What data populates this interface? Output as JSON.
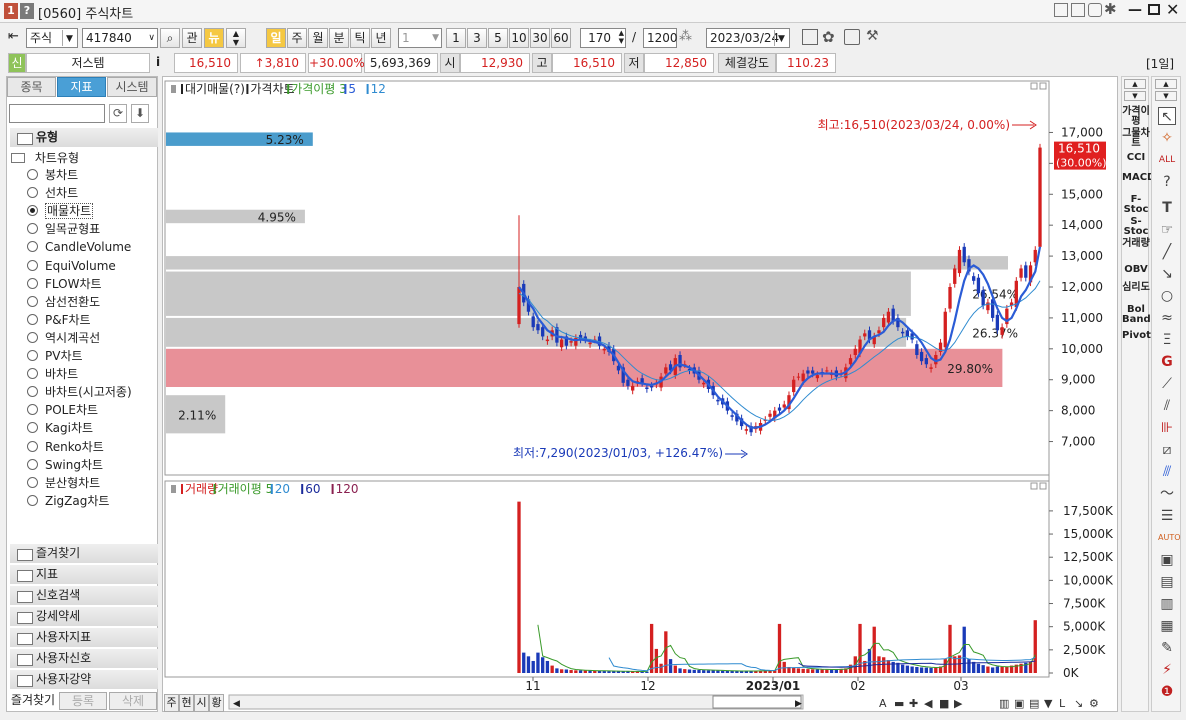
{
  "window": {
    "badge1": "1",
    "badge2": "?",
    "title": "[0560] 주식차트"
  },
  "toolbar": {
    "market": "주식",
    "code": "417840",
    "btn_gwan": "관",
    "btn_news": "뉴",
    "periods": [
      "일",
      "주",
      "월",
      "분",
      "틱",
      "년"
    ],
    "period_selected": "일",
    "interval_value": "1",
    "intervals": [
      "1",
      "3",
      "5",
      "10",
      "30",
      "60"
    ],
    "count": "170",
    "slash": "/",
    "total": "1200",
    "date": "2023/03/24"
  },
  "quote": {
    "prefix": "신",
    "name": "저스템",
    "info": "i",
    "price": "16,510",
    "change": "↑3,810",
    "pct": "+30.00%",
    "volume": "5,693,369",
    "open_label": "시",
    "open": "12,930",
    "high_label": "고",
    "high": "16,510",
    "low_label": "저",
    "low": "12,850",
    "strength_label": "체결강도",
    "strength": "110.23",
    "period_badge": "[1일]"
  },
  "left_panel": {
    "tabs": [
      "종목",
      "지표",
      "시스템"
    ],
    "active_tab": "지표",
    "type_header": "유형",
    "chart_type_header": "차트유형",
    "chart_types": [
      "봉차트",
      "선차트",
      "매물차트",
      "일목균형표",
      "CandleVolume",
      "EquiVolume",
      "FLOW차트",
      "삼선전환도",
      "P&F차트",
      "역시계곡선",
      "PV차트",
      "바차트",
      "바차트(시고저종)",
      "POLE차트",
      "Kagi차트",
      "Renko차트",
      "Swing차트",
      "분산형차트",
      "ZigZag차트"
    ],
    "selected_type": "매물차트",
    "folders": [
      "즐겨찾기",
      "지표",
      "신호검색",
      "강세약세",
      "사용자지표",
      "사용자신호",
      "사용자강약"
    ],
    "bottom_tabs": [
      "즐겨찾기",
      "등록",
      "삭제"
    ]
  },
  "price_panel": {
    "legend": [
      {
        "text": "대기매물(?)",
        "color": "#222222"
      },
      {
        "text": "가격차트",
        "color": "#222222"
      },
      {
        "text": "가격이평 3",
        "color": "#3a9a2a"
      },
      {
        "text": "5",
        "color": "#2b5cd6"
      },
      {
        "text": "12",
        "color": "#2f8bd0"
      }
    ],
    "high_note": "최고:16,510(2023/03/24, 0.00%)",
    "low_note": "최저:7,290(2023/01/03, +126.47%)",
    "last_price": "16,510",
    "last_pct": "(30.00%)",
    "y_ticks": [
      "17,000",
      "16,000",
      "15,000",
      "14,000",
      "13,000",
      "12,000",
      "11,000",
      "10,000",
      "9,000",
      "8,000",
      "7,000"
    ]
  },
  "volume_panel": {
    "legend": [
      {
        "text": "거래량",
        "color": "#d42020"
      },
      {
        "text": "거래이평 5",
        "color": "#3a9a2a"
      },
      {
        "text": "20",
        "color": "#2f8bd0"
      },
      {
        "text": "60",
        "color": "#1a2a9a"
      },
      {
        "text": "120",
        "color": "#8a2050"
      }
    ],
    "y_ticks": [
      "17,500K",
      "15,000K",
      "12,500K",
      "10,000K",
      "7,500K",
      "5,000K",
      "2,500K",
      "0K"
    ]
  },
  "x_axis": [
    "11",
    "12",
    "2023/01",
    "02",
    "03"
  ],
  "bottom_buttons": [
    "주",
    "현",
    "시",
    "황"
  ],
  "right_indicators": [
    "가격이평",
    "그물차트",
    "CCI",
    "MACD",
    "F-Stoc",
    "S-Stoc",
    "거래량",
    "OBV",
    "심리도",
    "Bol Band",
    "Pivot"
  ],
  "chart_data": {
    "type": "candlestick",
    "volume_profile": [
      {
        "low": 16500,
        "high": 17000,
        "pct": 5.23,
        "label": "5.23%",
        "color": "#4a9ccc"
      },
      {
        "low": 14000,
        "high": 14500,
        "pct": 4.95,
        "label": "4.95%",
        "color": "#c8c8c8"
      },
      {
        "low": 12500,
        "high": 13000,
        "pct": 0,
        "label": "",
        "color": "#c8c8c8"
      },
      {
        "low": 11000,
        "high": 12500,
        "pct": 26.54,
        "label": "26.54%",
        "color": "#c8c8c8"
      },
      {
        "low": 10000,
        "high": 11000,
        "pct": 26.37,
        "label": "26.37%",
        "color": "#c8c8c8"
      },
      {
        "low": 8700,
        "high": 10000,
        "pct": 29.8,
        "label": "29.80%",
        "color": "#e89098"
      },
      {
        "low": 7200,
        "high": 8500,
        "pct": 2.11,
        "label": "2.11%",
        "color": "#c8c8c8"
      }
    ],
    "close_series": [
      12000,
      11500,
      11200,
      10700,
      10600,
      10400,
      10300,
      10600,
      10200,
      10300,
      10100,
      10250,
      10350,
      10300,
      10300,
      10200,
      10300,
      10100,
      10000,
      9900,
      9600,
      9300,
      8900,
      8800,
      8800,
      8950,
      8900,
      8700,
      8750,
      8900,
      9100,
      9400,
      9300,
      9700,
      9400,
      9500,
      9300,
      9200,
      9000,
      8900,
      8700,
      8500,
      8300,
      8200,
      8000,
      7800,
      7650,
      7500,
      7400,
      7300,
      7500,
      7600,
      7700,
      7900,
      8000,
      8000,
      8200,
      8500,
      9000,
      9100,
      9200,
      9200,
      9200,
      9150,
      9200,
      9300,
      9200,
      9100,
      9200,
      9400,
      9700,
      10000,
      10300,
      10500,
      10300,
      10400,
      10600,
      11000,
      11200,
      10900,
      10700,
      10500,
      10400,
      10300,
      9800,
      9600,
      9500,
      9400,
      9800,
      10200,
      11200,
      12000,
      12600,
      13200,
      12800,
      12500,
      12200,
      11800,
      11400,
      11500,
      11000,
      10600,
      10700,
      11300,
      11500,
      12200,
      12600,
      12300,
      12700,
      13200,
      16510
    ],
    "ma5_series": [
      12000,
      11800,
      11500,
      11300,
      11000,
      10800,
      10600,
      10500,
      10400,
      10380,
      10350,
      10300,
      10280,
      10300,
      10280,
      10250,
      10220,
      10180,
      10100,
      9950,
      9800,
      9550,
      9300,
      9100,
      8950,
      8900,
      8880,
      8850,
      8830,
      8880,
      8950,
      9100,
      9250,
      9450,
      9500,
      9450,
      9400,
      9300,
      9150,
      9000,
      8850,
      8650,
      8450,
      8300,
      8150,
      8000,
      7850,
      7680,
      7550,
      7450,
      7450,
      7480,
      7550,
      7650,
      7780,
      7880,
      8000,
      8180,
      8400,
      8650,
      8900,
      9050,
      9150,
      9200,
      9200,
      9200,
      9200,
      9180,
      9180,
      9250,
      9400,
      9600,
      9850,
      10100,
      10300,
      10400,
      10450,
      10550,
      10750,
      10900,
      10950,
      10850,
      10700,
      10550,
      10400,
      10200,
      9950,
      9700,
      9600,
      9650,
      9900,
      10300,
      10900,
      11600,
      12200,
      12600,
      12700,
      12600,
      12400,
      12100,
      11700,
      11300,
      11000,
      10900,
      11000,
      11300,
      11700,
      11900,
      12200,
      12500,
      13300
    ],
    "ma12_series": [
      11800,
      11700,
      11600,
      11400,
      11200,
      11000,
      10900,
      10750,
      10650,
      10550,
      10480,
      10420,
      10380,
      10350,
      10320,
      10300,
      10270,
      10230,
      10180,
      10100,
      10000,
      9880,
      9730,
      9580,
      9430,
      9300,
      9200,
      9120,
      9050,
      9000,
      8980,
      9000,
      9050,
      9120,
      9200,
      9260,
      9300,
      9300,
      9280,
      9220,
      9120,
      9000,
      8860,
      8710,
      8560,
      8420,
      8280,
      8150,
      8030,
      7920,
      7830,
      7760,
      7700,
      7680,
      7690,
      7730,
      7800,
      7900,
      8030,
      8180,
      8350,
      8500,
      8640,
      8760,
      8860,
      8940,
      9000,
      9050,
      9090,
      9130,
      9200,
      9280,
      9380,
      9500,
      9620,
      9740,
      9850,
      9970,
      10100,
      10220,
      10320,
      10380,
      10400,
      10380,
      10350,
      10300,
      10220,
      10120,
      10020,
      9950,
      9950,
      10020,
      10200,
      10450,
      10700,
      10950,
      11150,
      11300,
      11400,
      11450,
      11450,
      11400,
      11350,
      11350,
      11400,
      11450,
      11550,
      11650,
      11800,
      11950,
      12200
    ],
    "volume_k": [
      18500,
      2200,
      1800,
      1300,
      2200,
      1700,
      1300,
      800,
      500,
      400,
      380,
      320,
      290,
      280,
      260,
      250,
      240,
      220,
      210,
      200,
      190,
      180,
      180,
      170,
      160,
      150,
      140,
      150,
      5300,
      2600,
      1000,
      4500,
      1500,
      800,
      500,
      420,
      380,
      340,
      330,
      310,
      290,
      280,
      260,
      240,
      230,
      220,
      210,
      200,
      210,
      220,
      230,
      250,
      260,
      280,
      300,
      5300,
      1200,
      650,
      600,
      500,
      450,
      420,
      400,
      380,
      370,
      360,
      380,
      400,
      450,
      500,
      900,
      1800,
      5300,
      1300,
      2600,
      5000,
      1800,
      1700,
      1400,
      1200,
      1100,
      900,
      800,
      700,
      650,
      600,
      580,
      550,
      600,
      700,
      1500,
      5200,
      1800,
      1900,
      5000,
      1500,
      1200,
      1000,
      850,
      700,
      600,
      700,
      650,
      700,
      800,
      900,
      1000,
      1100,
      1200,
      5700
    ],
    "x_labels": [
      "11",
      "12",
      "2023/01",
      "02",
      "03"
    ],
    "ylim": [
      6500,
      17500
    ],
    "volume_ylim": [
      0,
      19000
    ],
    "high": {
      "value": 16510,
      "date": "2023/03/24"
    },
    "low": {
      "value": 7290,
      "date": "2023/01/03"
    }
  }
}
